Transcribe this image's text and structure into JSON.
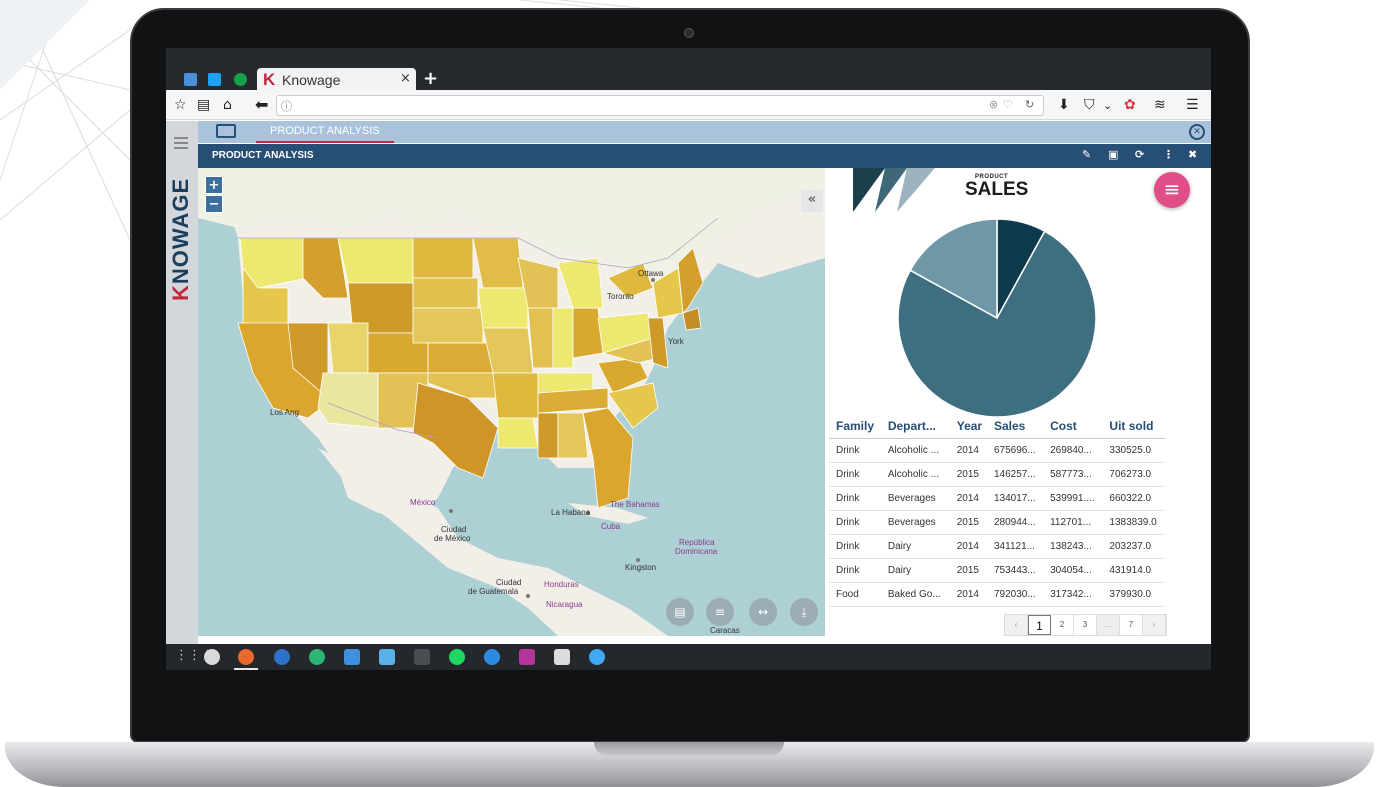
{
  "browser": {
    "tab_title": "Knowage",
    "tab_close": "×",
    "new_tab": "+",
    "url_info_icon": "info-icon",
    "accent": "#c0283b"
  },
  "sidebar": {
    "logo_k": "K",
    "logo_rest": "NOWAGE"
  },
  "document": {
    "tab_label": "PRODUCT ANALYSIS",
    "title": "PRODUCT ANALYSIS",
    "header_color": "#274f76",
    "docbar_color": "#a9c3dc"
  },
  "map": {
    "zoom_in": "+",
    "zoom_out": "−",
    "collapse": "«",
    "labels": [
      "Ottawa",
      "Toronto",
      "York",
      "Los Ang",
      "México",
      "Ciudad",
      "de México",
      "La Habana",
      "The Bahamas",
      "Cuba",
      "República",
      "Dominicana",
      "Kingston",
      "Ciudad",
      "de Guatemala",
      "Honduras",
      "Nicaragua",
      "Caracas"
    ]
  },
  "widget": {
    "header_small": "PRODUCT",
    "header_big": "SALES",
    "fab_icon": "menu-icon",
    "chart_data": {
      "type": "pie",
      "values": [
        8,
        75,
        17
      ],
      "colors": [
        "#0e3a4c",
        "#3d6f80",
        "#6e98a7"
      ]
    },
    "table": {
      "columns": [
        "Family",
        "Depart...",
        "Year",
        "Sales",
        "Cost",
        "Uit sold"
      ],
      "rows": [
        [
          "Drink",
          "Alcoholic ...",
          "2014",
          "675696...",
          "269840...",
          "330525.0"
        ],
        [
          "Drink",
          "Alcoholic ...",
          "2015",
          "146257...",
          "587773...",
          "706273.0"
        ],
        [
          "Drink",
          "Beverages",
          "2014",
          "134017...",
          "539991....",
          "660322.0"
        ],
        [
          "Drink",
          "Beverages",
          "2015",
          "280944...",
          "112701...",
          "1383839.0"
        ],
        [
          "Drink",
          "Dairy",
          "2014",
          "341121...",
          "138243...",
          "203237.0"
        ],
        [
          "Drink",
          "Dairy",
          "2015",
          "753443...",
          "304054...",
          "431914.0"
        ],
        [
          "Food",
          "Baked Go...",
          "2014",
          "792030...",
          "317342...",
          "379930.0"
        ]
      ]
    },
    "pager": {
      "prev": "‹",
      "pages": [
        "1",
        "2",
        "3"
      ],
      "ellipsis": "...",
      "last": "7",
      "next": "›"
    }
  }
}
